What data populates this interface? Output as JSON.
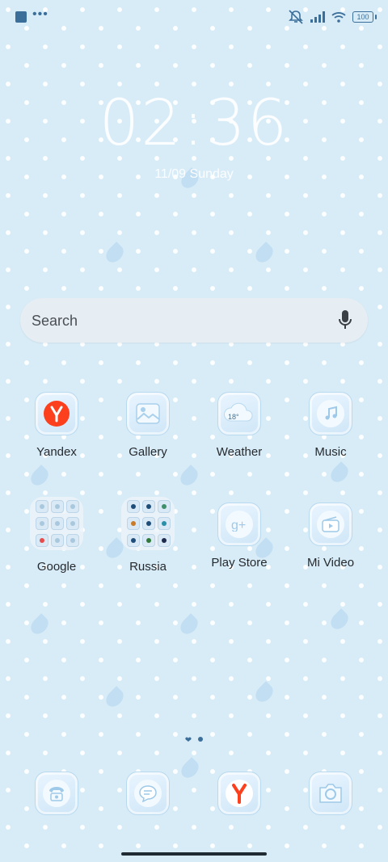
{
  "status_bar": {
    "battery": "100"
  },
  "lock": {
    "time": "02:36",
    "date": "11/09 Sunday"
  },
  "search": {
    "placeholder": "Search"
  },
  "apps": [
    {
      "label": "Yandex"
    },
    {
      "label": "Gallery"
    },
    {
      "label": "Weather",
      "temp": "18°"
    },
    {
      "label": "Music"
    },
    {
      "label": "Google"
    },
    {
      "label": "Russia"
    },
    {
      "label": "Play Store"
    },
    {
      "label": "Mi Video"
    }
  ],
  "dock": [
    {
      "name": "phone-icon"
    },
    {
      "name": "messages-icon"
    },
    {
      "name": "yandex-browser-icon"
    },
    {
      "name": "camera-icon"
    }
  ],
  "colors": {
    "background": "#d8ecf8",
    "accent": "#3b6f9a",
    "yandex_red": "#fc3f1d"
  }
}
